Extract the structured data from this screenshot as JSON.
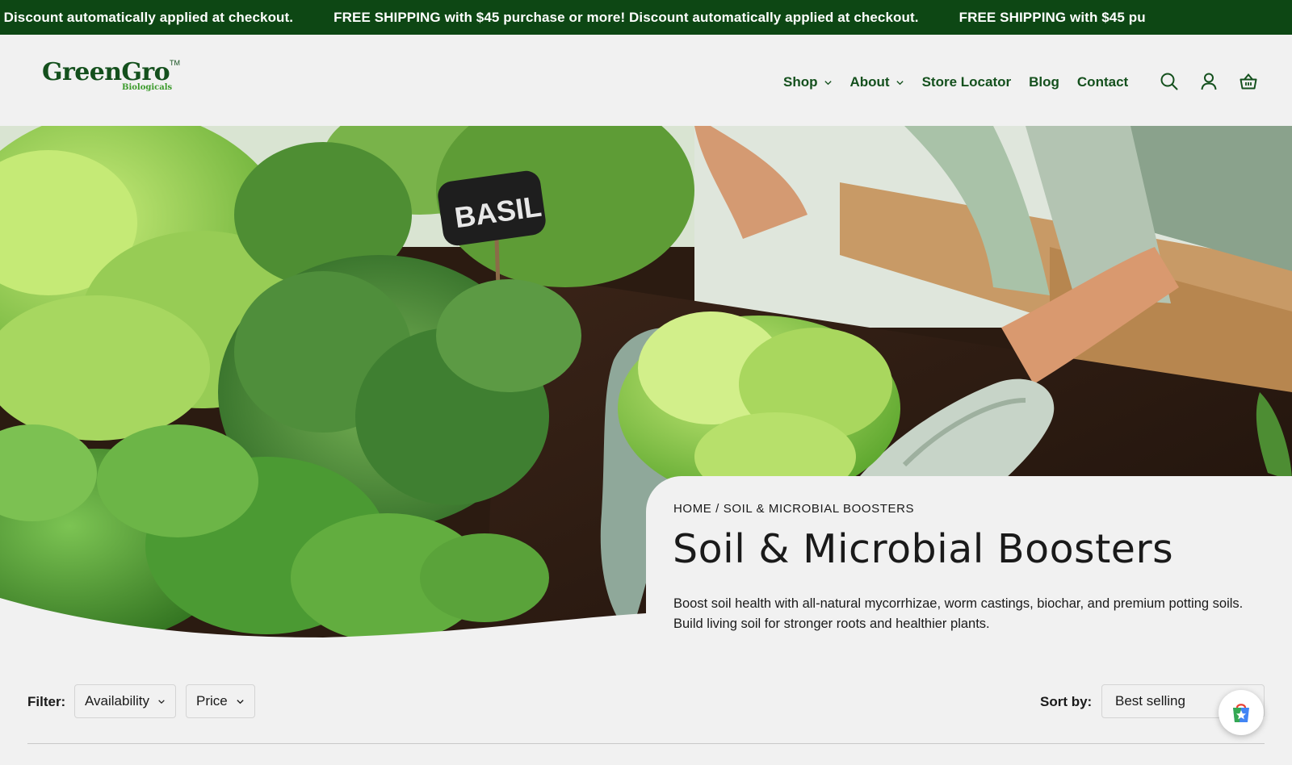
{
  "announcement": {
    "messages": [
      "! Discount automatically applied at checkout.",
      "FREE SHIPPING with $45 purchase or more! Discount automatically applied at checkout.",
      "FREE SHIPPING with $45 pu"
    ]
  },
  "brand": {
    "name": "GreenGro",
    "tagline": "Biologicals",
    "mark": "TM"
  },
  "nav": {
    "items": [
      {
        "label": "Shop"
      },
      {
        "label": "About"
      },
      {
        "label": "Store Locator"
      },
      {
        "label": "Blog"
      },
      {
        "label": "Contact"
      }
    ]
  },
  "icons": {
    "search": "search-icon",
    "account": "user-icon",
    "cart": "basket-icon"
  },
  "hero": {
    "sign_text": "BASIL"
  },
  "breadcrumb": {
    "home": "HOME",
    "separator": " / ",
    "current": "SOIL & MICROBIAL BOOSTERS"
  },
  "page": {
    "title": "Soil & Microbial Boosters",
    "description_line1": "Boost soil health with all-natural mycorrhizae, worm castings, biochar, and premium potting soils.",
    "description_line2": "Build living soil for stronger roots and healthier plants."
  },
  "filters": {
    "label": "Filter:",
    "availability": "Availability",
    "price": "Price"
  },
  "sort": {
    "label": "Sort by:",
    "value": "Best selling"
  },
  "colors": {
    "brand_green": "#0d4714",
    "nav_green": "#14501d",
    "accent_green": "#3b9a2b",
    "background": "#f1f1f1"
  }
}
